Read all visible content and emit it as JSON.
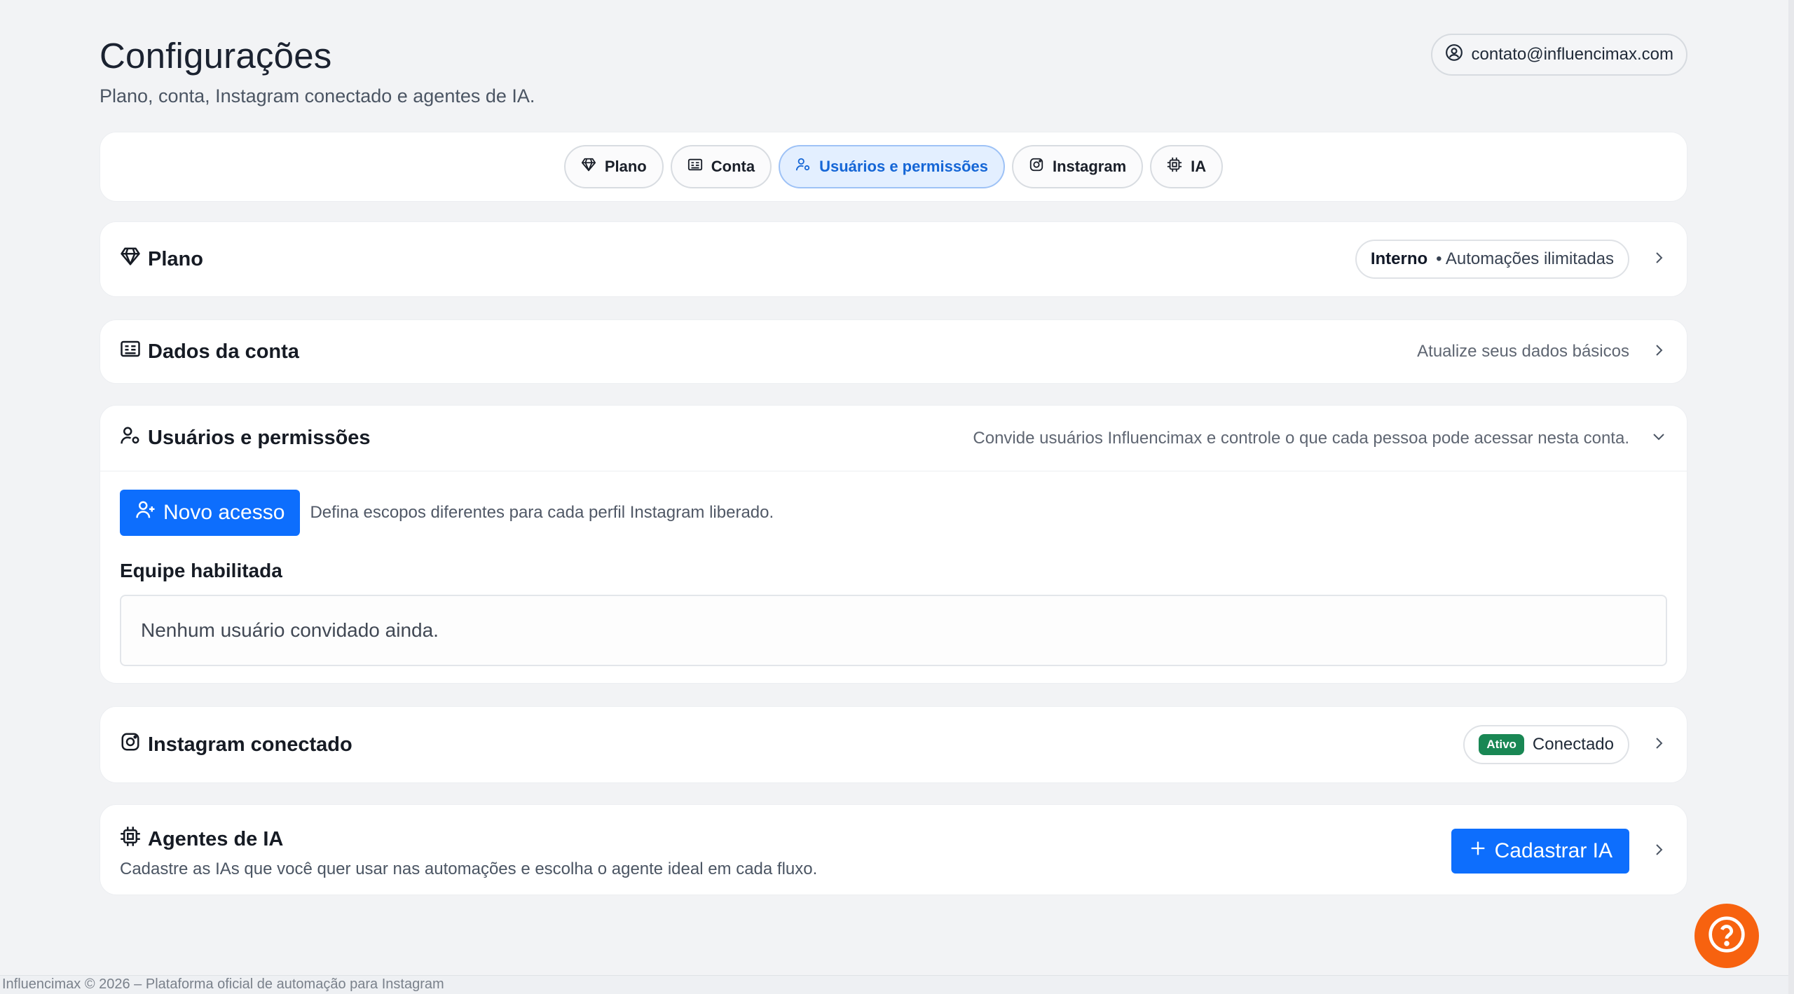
{
  "header": {
    "title": "Configurações",
    "subtitle": "Plano, conta, Instagram conectado e agentes de IA.",
    "user_email": "contato@influencimax.com"
  },
  "tabs": [
    {
      "label": "Plano",
      "icon": "diamond-icon",
      "active": false
    },
    {
      "label": "Conta",
      "icon": "id-card-icon",
      "active": false
    },
    {
      "label": "Usuários e permissões",
      "icon": "user-gear-icon",
      "active": true
    },
    {
      "label": "Instagram",
      "icon": "instagram-icon",
      "active": false
    },
    {
      "label": "IA",
      "icon": "cpu-icon",
      "active": false
    }
  ],
  "plan": {
    "title": "Plano",
    "tier": "Interno",
    "detail": "• Automações ilimitadas"
  },
  "account": {
    "title": "Dados da conta",
    "hint": "Atualize seus dados básicos"
  },
  "users": {
    "title": "Usuários e permissões",
    "description": "Convide usuários Influencimax e controle o que cada pessoa pode acessar nesta conta.",
    "new_access_label": "Novo acesso",
    "scopes_hint": "Defina escopos diferentes para cada perfil Instagram liberado.",
    "team_label": "Equipe habilitada",
    "empty_text": "Nenhum usuário convidado ainda."
  },
  "instagram": {
    "title": "Instagram conectado",
    "badge": "Ativo",
    "status": "Conectado"
  },
  "ai": {
    "title": "Agentes de IA",
    "description": "Cadastre as IAs que você quer usar nas automações e escolha o agente ideal em cada fluxo.",
    "register_label": "Cadastrar IA"
  },
  "footer": {
    "text": "Influencimax © 2026 – Plataforma oficial de automação para Instagram"
  },
  "colors": {
    "primary": "#0d6efd",
    "active_tab_bg": "#e3efff",
    "active_tab_text": "#1566d6",
    "success": "#198754",
    "help": "#f7620f",
    "background": "#f2f3f5"
  }
}
